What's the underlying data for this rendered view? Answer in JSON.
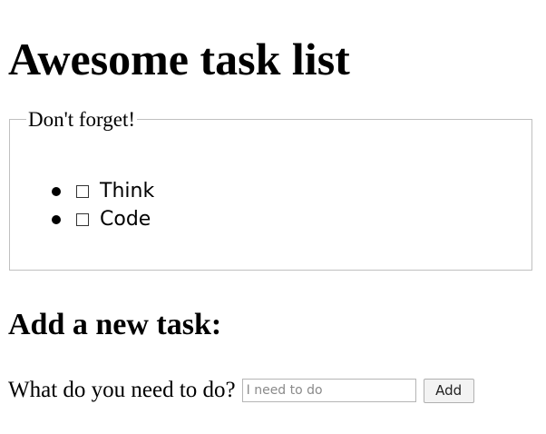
{
  "page": {
    "title": "Awesome task list"
  },
  "task_group": {
    "legend": "Don't forget!",
    "tasks": [
      {
        "label": "Think",
        "checked": false
      },
      {
        "label": "Code",
        "checked": false
      }
    ]
  },
  "new_task": {
    "heading": "Add a new task:",
    "prompt": "What do you need to do?",
    "placeholder": "I need to do",
    "value": "",
    "add_label": "Add"
  },
  "icons": {
    "bullet": "bullet-icon",
    "checkbox": "checkbox-unchecked"
  }
}
